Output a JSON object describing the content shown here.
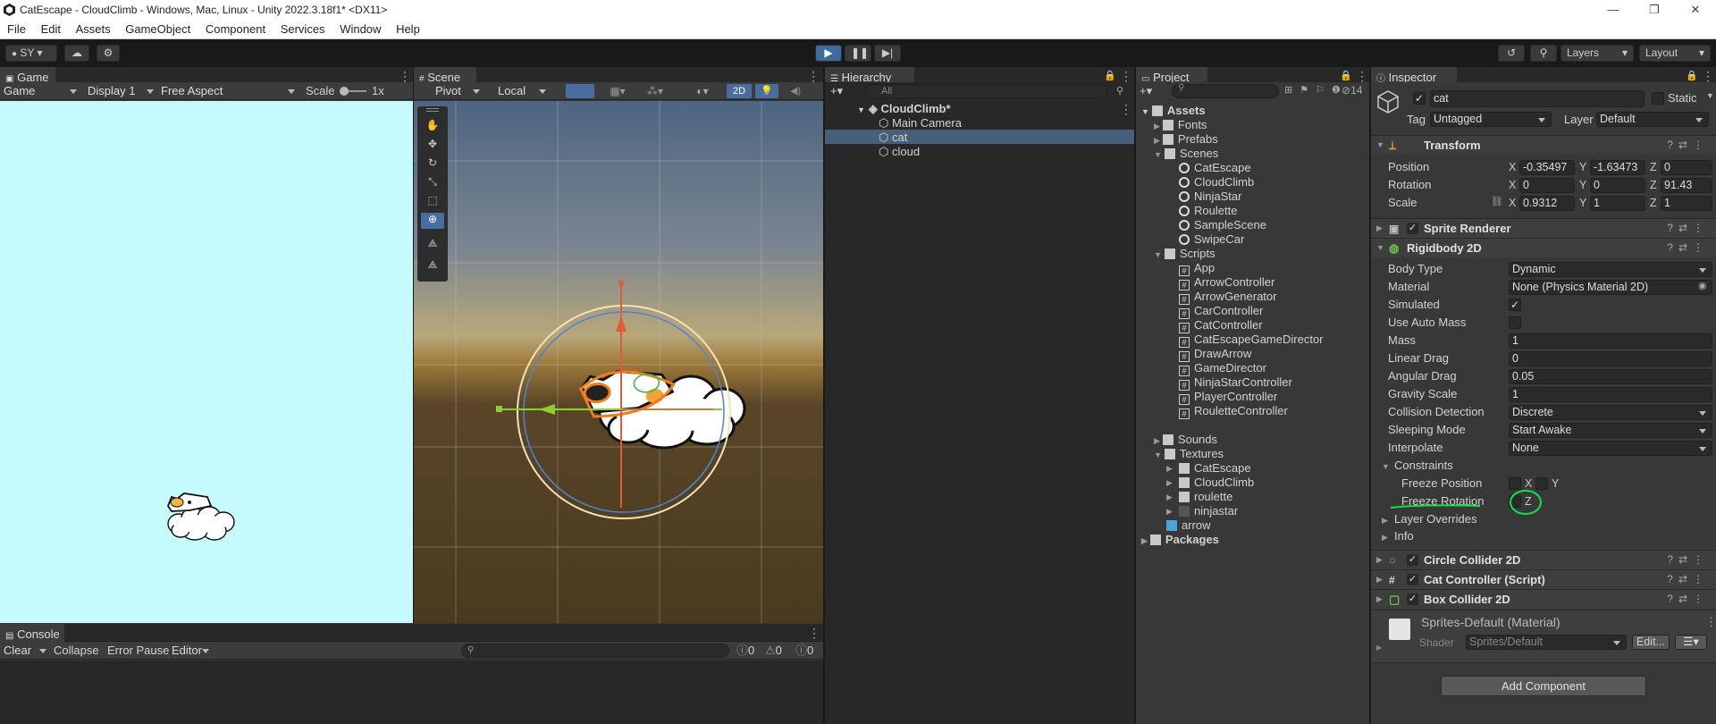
{
  "window": {
    "title": "CatEscape - CloudClimb - Windows, Mac, Linux - Unity 2022.3.18f1* <DX11>",
    "controls": [
      "—",
      "❐",
      "✕"
    ]
  },
  "menu": [
    "File",
    "Edit",
    "Assets",
    "GameObject",
    "Component",
    "Services",
    "Window",
    "Help"
  ],
  "toolbar": {
    "account": "SY",
    "layers": "Layers",
    "layout": "Layout"
  },
  "game": {
    "tab": "Game",
    "mode": "Game",
    "display": "Display 1",
    "aspect": "Free Aspect",
    "scale_label": "Scale",
    "scale_value": "1x",
    "bg": "#c5fbfe"
  },
  "scene": {
    "tab": "Scene",
    "pivot": "Pivot",
    "local": "Local",
    "mode_2d": "2D"
  },
  "hierarchy": {
    "tab": "Hierarchy",
    "search": "All",
    "scene": "CloudClimb*",
    "items": [
      "Main Camera",
      "cat",
      "cloud"
    ]
  },
  "project": {
    "tab": "Project",
    "count": "14",
    "root": "Assets",
    "fonts": "Fonts",
    "prefabs": "Prefabs",
    "scenes": "Scenes",
    "scene_items": [
      "CatEscape",
      "CloudClimb",
      "NinjaStar",
      "Roulette",
      "SampleScene",
      "SwipeCar"
    ],
    "scripts": "Scripts",
    "script_items": [
      "App",
      "ArrowController",
      "ArrowGenerator",
      "CarController",
      "CatController",
      "CatEscapeGameDirector",
      "DrawArrow",
      "GameDirector",
      "NinjaStarController",
      "PlayerController",
      "RouletteController"
    ],
    "sounds": "Sounds",
    "textures": "Textures",
    "texture_items": [
      "CatEscape",
      "CloudClimb",
      "roulette",
      "ninjastar"
    ],
    "arrow": "arrow",
    "packages": "Packages"
  },
  "inspector": {
    "tab": "Inspector",
    "name": "cat",
    "static": "Static",
    "tag_label": "Tag",
    "tag": "Untagged",
    "layer_label": "Layer",
    "layer": "Default",
    "transform": {
      "title": "Transform",
      "position_label": "Position",
      "rotation_label": "Rotation",
      "scale_label": "Scale",
      "pos": [
        "-0.35497",
        "-1.63473",
        "0"
      ],
      "rot": [
        "0",
        "0",
        "91.43"
      ],
      "scale": [
        "0.9312",
        "1",
        "1"
      ]
    },
    "sprite_renderer": "Sprite Renderer",
    "rigidbody": {
      "title": "Rigidbody 2D",
      "rows": [
        {
          "label": "Body Type",
          "value": "Dynamic",
          "kind": "dropdown"
        },
        {
          "label": "Material",
          "value": "None (Physics Material 2D)",
          "kind": "object"
        },
        {
          "label": "Simulated",
          "value": "✓",
          "kind": "check"
        },
        {
          "label": "Use Auto Mass",
          "value": "",
          "kind": "check"
        },
        {
          "label": "Mass",
          "value": "1",
          "kind": "text"
        },
        {
          "label": "Linear Drag",
          "value": "0",
          "kind": "text"
        },
        {
          "label": "Angular Drag",
          "value": "0.05",
          "kind": "text"
        },
        {
          "label": "Gravity Scale",
          "value": "1",
          "kind": "text"
        },
        {
          "label": "Collision Detection",
          "value": "Discrete",
          "kind": "dropdown"
        },
        {
          "label": "Sleeping Mode",
          "value": "Start Awake",
          "kind": "dropdown"
        },
        {
          "label": "Interpolate",
          "value": "None",
          "kind": "dropdown"
        }
      ],
      "constraints": "Constraints",
      "freeze_position": "Freeze Position",
      "freeze_rotation": "Freeze Rotation",
      "layer_overrides": "Layer Overrides",
      "info": "Info"
    },
    "components": [
      "Circle Collider 2D",
      "Cat Controller (Script)",
      "Box Collider 2D"
    ],
    "material": {
      "name": "Sprites-Default (Material)",
      "shader_label": "Shader",
      "shader": "Sprites/Default",
      "edit": "Edit..."
    },
    "add_component": "Add Component"
  },
  "console": {
    "tab": "Console",
    "clear": "Clear",
    "collapse": "Collapse",
    "error_pause": "Error Pause",
    "editor": "Editor",
    "counts": [
      "0",
      "0",
      "0"
    ]
  }
}
